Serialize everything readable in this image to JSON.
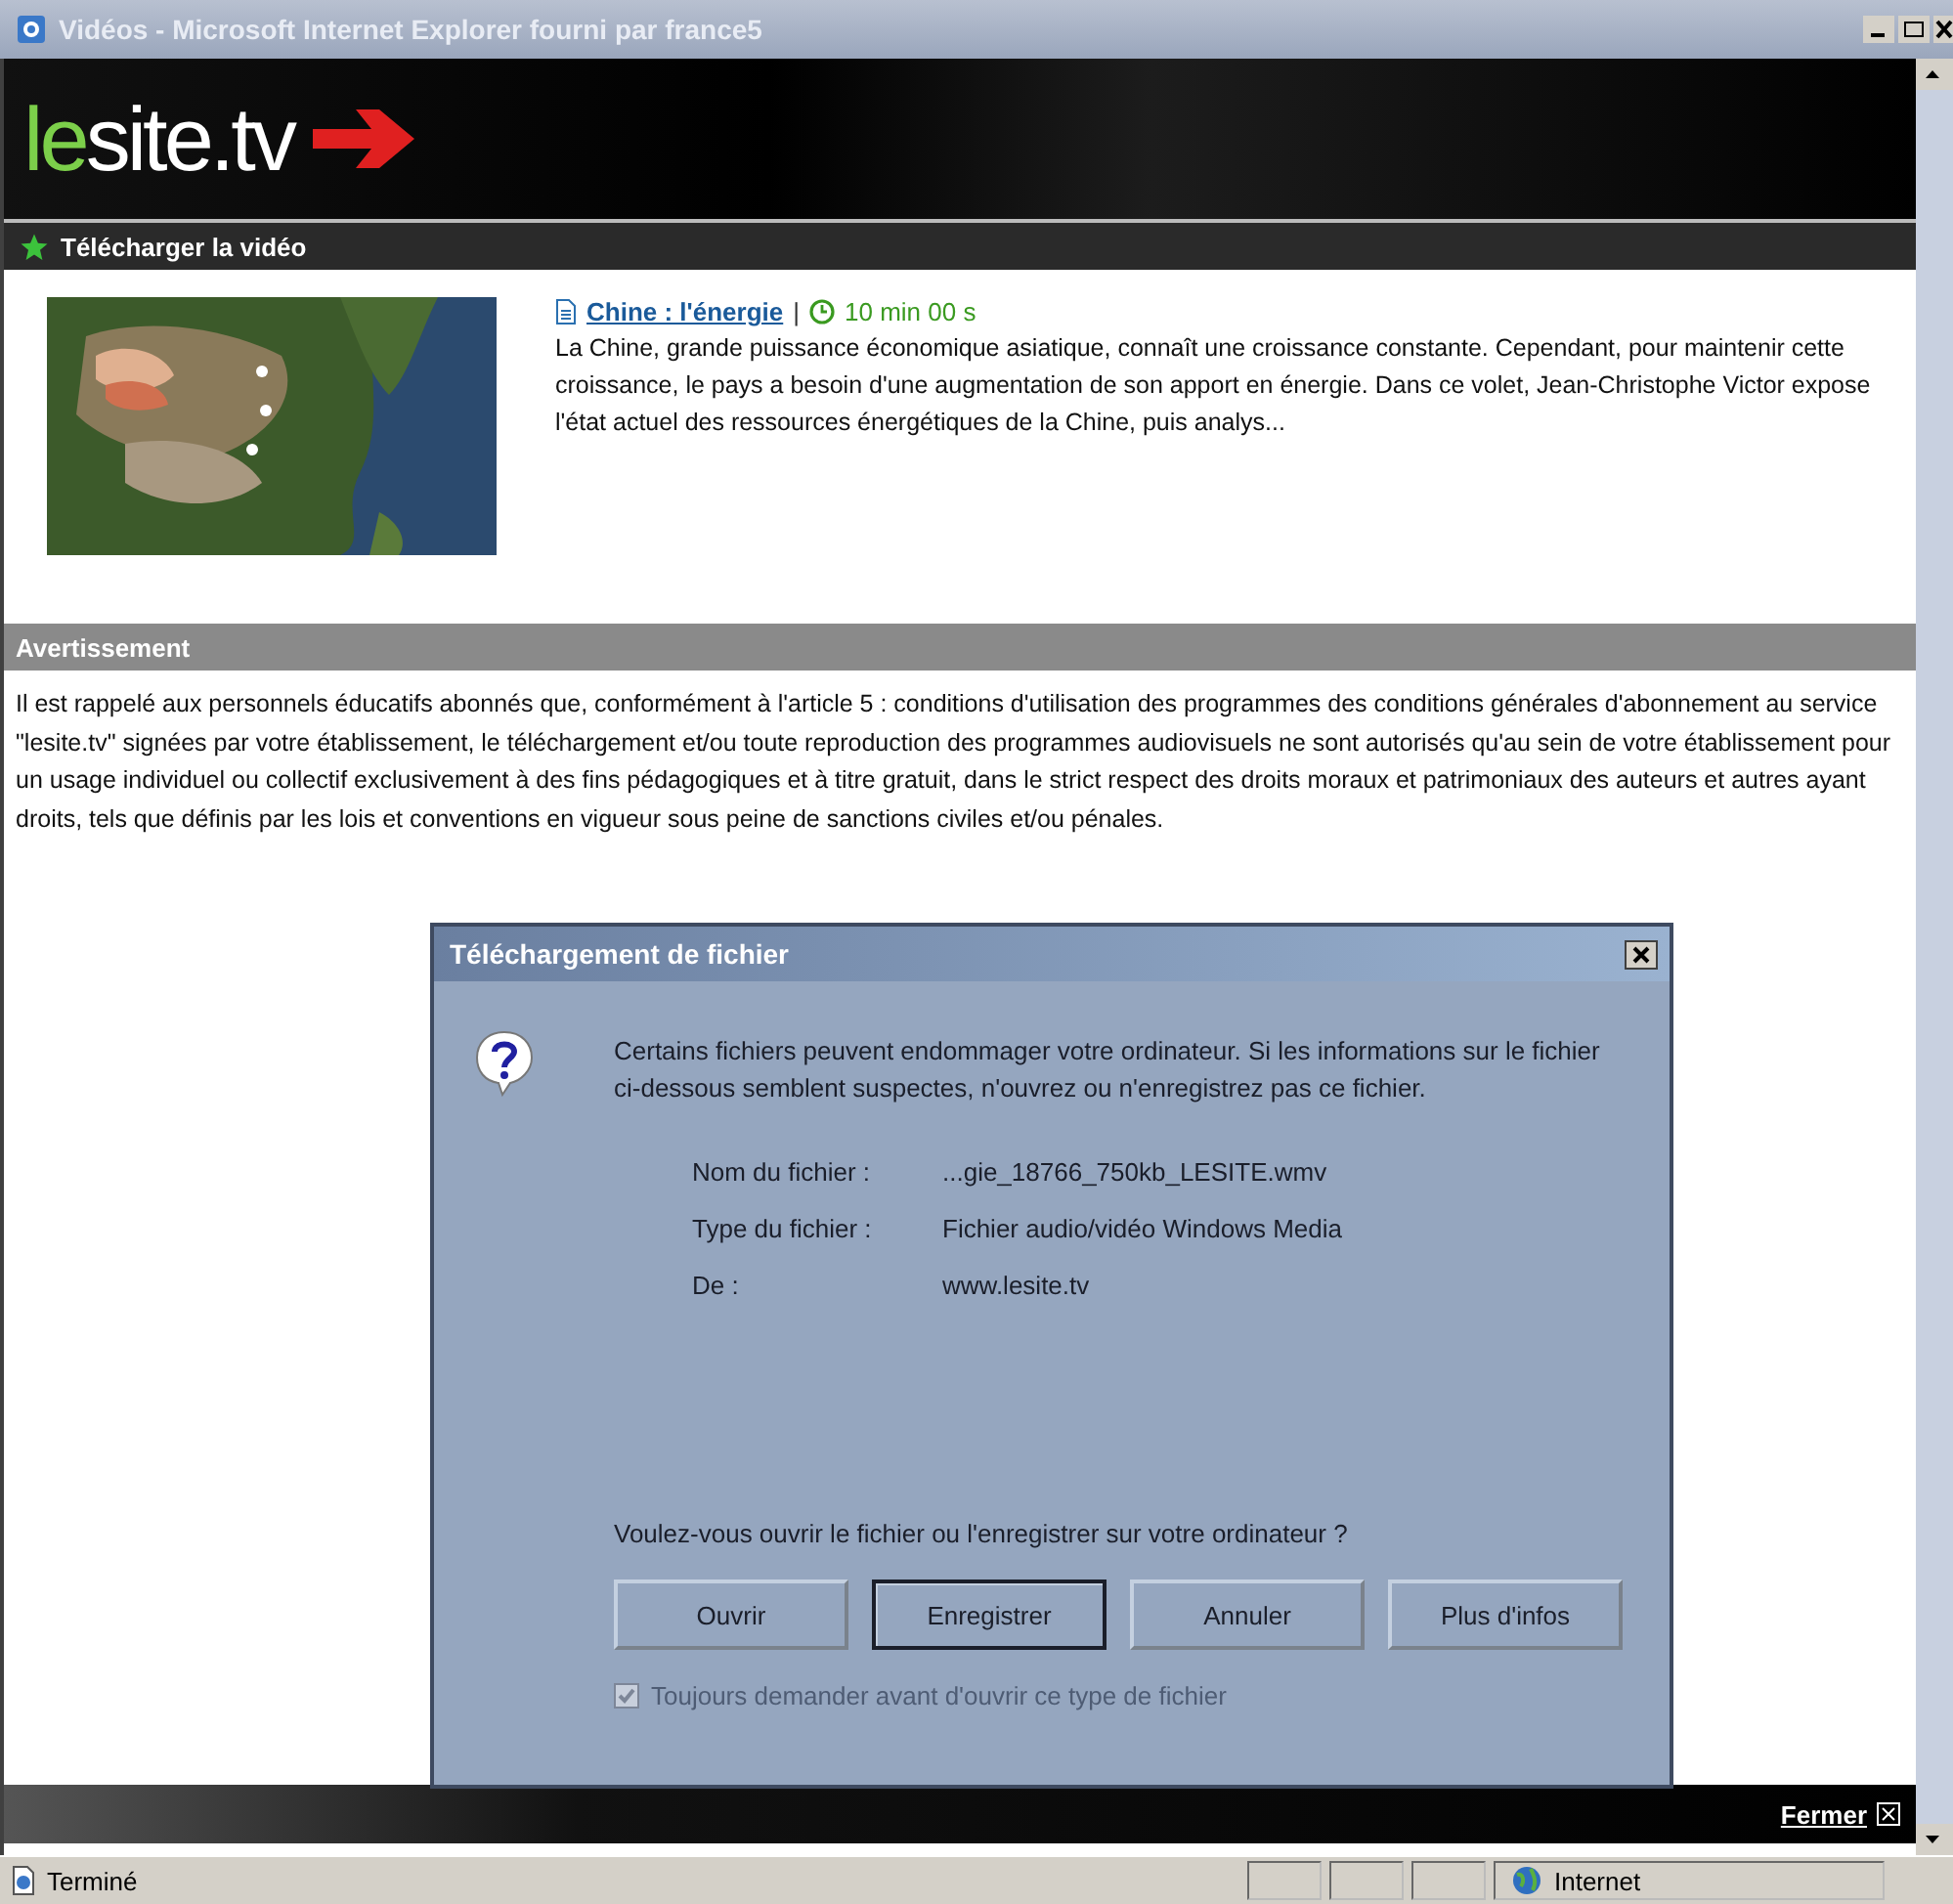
{
  "window": {
    "title": "Vidéos - Microsoft Internet Explorer fourni par france5"
  },
  "header": {
    "logo": {
      "accent": "le",
      "rest": "site.tv"
    },
    "section_title": "Télécharger la vidéo"
  },
  "video": {
    "kind": "picture",
    "title": "Chine : l'énergie",
    "separator": "|",
    "duration": "10 min 00 s",
    "description": "La Chine, grande puissance économique asiatique, connaît une croissance constante. Cependant, pour maintenir cette croissance, le pays a besoin d'une augmentation de son apport en énergie. Dans ce volet, Jean-Christophe Victor expose l'état actuel des ressources énergétiques de la Chine, puis analys..."
  },
  "warning": {
    "title": "Avertissement",
    "text": "Il est rappelé aux personnels éducatifs abonnés que, conformément à l'article 5 : conditions d'utilisation des programmes des conditions générales d'abonnement au service \"lesite.tv\" signées par votre établissement, le téléchargement et/ou toute reproduction des programmes audiovisuels ne sont autorisés qu'au sein de votre établissement pour un usage individuel ou collectif exclusivement à des fins pédagogiques et à titre gratuit, dans le strict respect des droits moraux et patrimoniaux des auteurs et autres ayant droits, tels que définis par les lois et conventions en vigueur sous peine de sanctions civiles et/ou pénales."
  },
  "footer": {
    "close_link": "Fermer"
  },
  "dialog": {
    "title": "Téléchargement de fichier",
    "message": "Certains fichiers peuvent endommager votre ordinateur. Si les informations sur le fichier ci-dessous semblent suspectes, n'ouvrez ou n'enregistrez pas ce fichier.",
    "fields": [
      {
        "label": "Nom du fichier :",
        "value": "...gie_18766_750kb_LESITE.wmv"
      },
      {
        "label": "Type du fichier :",
        "value": "Fichier audio/vidéo Windows Media"
      },
      {
        "label": "De :",
        "value": "www.lesite.tv"
      }
    ],
    "question": "Voulez-vous ouvrir le fichier ou l'enregistrer sur votre ordinateur ?",
    "buttons": [
      {
        "label": "Ouvrir",
        "focused": false
      },
      {
        "label": "Enregistrer",
        "focused": true
      },
      {
        "label": "Annuler",
        "focused": false
      },
      {
        "label": "Plus d'infos",
        "focused": false
      }
    ],
    "checkbox": {
      "label": "Toujours demander avant d'ouvrir ce type de fichier",
      "checked": true,
      "disabled": true
    }
  },
  "status_bar": {
    "status": "Terminé",
    "zone": "Internet"
  }
}
